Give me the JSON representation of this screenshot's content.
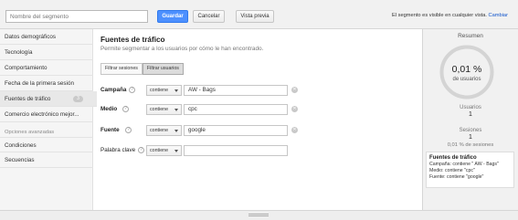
{
  "header": {
    "segment_name_placeholder": "Nombre del segmento",
    "save_label": "Guardar",
    "cancel_label": "Cancelar",
    "preview_label": "Vista previa",
    "visibility_text": "El segmento es visible en cualquier vista.",
    "change_link": "Cambiar",
    "accent_color": "#4d90fe",
    "link_color": "#1155cc"
  },
  "sidebar": {
    "items": [
      {
        "label": "Datos demográficos"
      },
      {
        "label": "Tecnología"
      },
      {
        "label": "Comportamiento"
      },
      {
        "label": "Fecha de la primera sesión"
      },
      {
        "label": "Fuentes de tráfico",
        "badge": "3",
        "active": true
      },
      {
        "label": "Comercio electrónico mejor..."
      }
    ],
    "advanced_heading": "Opciones avanzadas",
    "advanced_items": [
      {
        "label": "Condiciones"
      },
      {
        "label": "Secuencias"
      }
    ]
  },
  "main": {
    "title": "Fuentes de tráfico",
    "subtitle": "Permite segmentar a los usuarios por cómo le han encontrado.",
    "tabs": [
      {
        "label": "Filtrar sesiones",
        "selected": false
      },
      {
        "label": "Filtrar usuarios",
        "selected": true
      }
    ],
    "rows": [
      {
        "label": "Campaña",
        "operator": "contiene",
        "value": "AW - Bags"
      },
      {
        "label": "Medio",
        "operator": "contiene",
        "value": "cpc"
      },
      {
        "label": "Fuente",
        "operator": "contiene",
        "value": "google"
      },
      {
        "label": "Palabra clave",
        "operator": "contiene",
        "value": ""
      }
    ],
    "help_glyph": "?",
    "clear_glyph": "✕"
  },
  "summary": {
    "title": "Resumen",
    "percent": "0,01 %",
    "percent_caption": "de usuarios",
    "users_label": "Usuarios",
    "users_value": "1",
    "sessions_label": "Sesiones",
    "sessions_value": "1",
    "sessions_percent": "0,01 % de sesiones",
    "box_title": "Fuentes de tráfico",
    "box_lines": [
      "Campaña: contiene \" AW - Bags\"",
      "Medio: contiene \"cpc\"",
      "Fuente: contiene \"google\""
    ]
  }
}
